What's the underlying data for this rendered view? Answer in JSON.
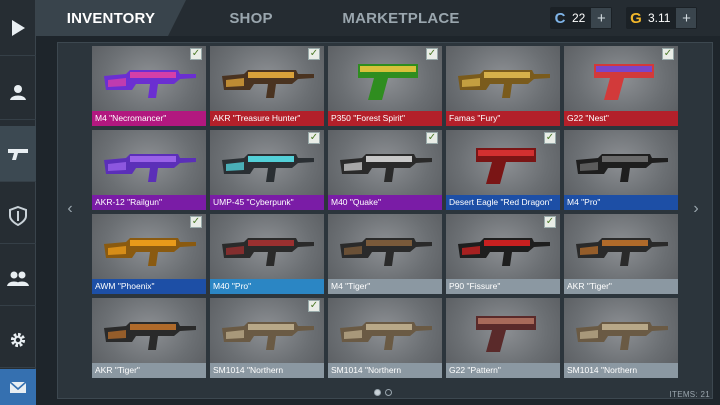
{
  "tabs": [
    {
      "label": "INVENTORY",
      "active": true
    },
    {
      "label": "SHOP",
      "active": false
    },
    {
      "label": "MARKETPLACE",
      "active": false
    }
  ],
  "currency": {
    "coins": {
      "icon": "C",
      "value": "22",
      "color": "#7fb4e8"
    },
    "gold": {
      "icon": "G",
      "value": "3.11",
      "color": "#f1b62b"
    },
    "add_label": "+"
  },
  "sidebar": [
    "play-icon",
    "profile-icon",
    "pistol-icon",
    "clan-shield-icon",
    "friends-icon",
    "gear-icon",
    "mail-icon"
  ],
  "nav": {
    "prev": "‹",
    "next": "›"
  },
  "items": [
    {
      "name": "M4 \"Necromancer\"",
      "rarity": "pink",
      "equipped": true
    },
    {
      "name": "AKR \"Treasure Hunter\"",
      "rarity": "red",
      "equipped": true
    },
    {
      "name": "P350 \"Forest Spirit\"",
      "rarity": "red",
      "equipped": true
    },
    {
      "name": "Famas \"Fury\"",
      "rarity": "red",
      "equipped": false
    },
    {
      "name": "G22 \"Nest\"",
      "rarity": "red",
      "equipped": true
    },
    {
      "name": "AKR-12 \"Railgun\"",
      "rarity": "purple",
      "equipped": false
    },
    {
      "name": "UMP-45 \"Cyberpunk\"",
      "rarity": "purple",
      "equipped": true
    },
    {
      "name": "M40 \"Quake\"",
      "rarity": "purple",
      "equipped": true
    },
    {
      "name": "Desert Eagle \"Red Dragon\"",
      "rarity": "blue",
      "equipped": true
    },
    {
      "name": "M4 \"Pro\"",
      "rarity": "blue",
      "equipped": false
    },
    {
      "name": "AWM \"Phoenix\"",
      "rarity": "blue",
      "equipped": true
    },
    {
      "name": "M40 \"Pro\"",
      "rarity": "cyan",
      "equipped": false
    },
    {
      "name": "M4 \"Tiger\"",
      "rarity": "grey",
      "equipped": false
    },
    {
      "name": "P90 \"Fissure\"",
      "rarity": "grey",
      "equipped": true
    },
    {
      "name": "AKR \"Tiger\"",
      "rarity": "grey",
      "equipped": false
    },
    {
      "name": "AKR \"Tiger\"",
      "rarity": "grey",
      "equipped": false
    },
    {
      "name": "SM1014 \"Northern",
      "rarity": "grey",
      "equipped": true
    },
    {
      "name": "SM1014 \"Northern",
      "rarity": "grey",
      "equipped": false
    },
    {
      "name": "G22 \"Pattern\"",
      "rarity": "grey",
      "equipped": false
    },
    {
      "name": "SM1014 \"Northern",
      "rarity": "grey",
      "equipped": false
    }
  ],
  "pagination": {
    "pages": 2,
    "current": 1
  },
  "items_count": "ITEMS: 21"
}
